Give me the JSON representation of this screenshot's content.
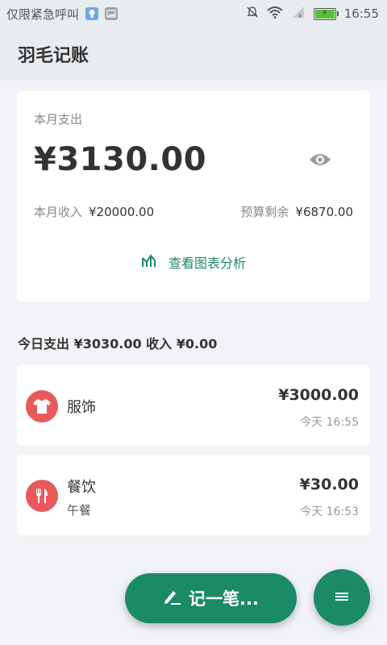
{
  "status_bar": {
    "carrier": "仅限紧急呼叫",
    "time": "16:55",
    "icons": [
      "bulb-notify-icon",
      "image-notify-icon",
      "mute-icon",
      "wifi-icon",
      "signal-icon",
      "battery-icon"
    ]
  },
  "app_bar": {
    "title": "羽毛记账"
  },
  "summary": {
    "month_expense_label": "本月支出",
    "month_expense_value": "¥3130.00",
    "month_income_label": "本月收入",
    "month_income_value": "¥20000.00",
    "budget_left_label": "预算剩余",
    "budget_left_value": "¥6870.00",
    "chart_link_label": "查看图表分析"
  },
  "today": {
    "summary_text": "今日支出 ¥3030.00 收入 ¥0.00"
  },
  "entries": [
    {
      "category": "服饰",
      "note": "",
      "amount": "¥3000.00",
      "time": "今天 16:55",
      "icon": "shirt-icon"
    },
    {
      "category": "餐饮",
      "note": "午餐",
      "amount": "¥30.00",
      "time": "今天 16:53",
      "icon": "fork-knife-icon"
    }
  ],
  "actions": {
    "record_label": "记一笔..."
  },
  "colors": {
    "accent": "#1b8a66",
    "category_red": "#e85a5a",
    "appbar": "#e9ecef"
  }
}
